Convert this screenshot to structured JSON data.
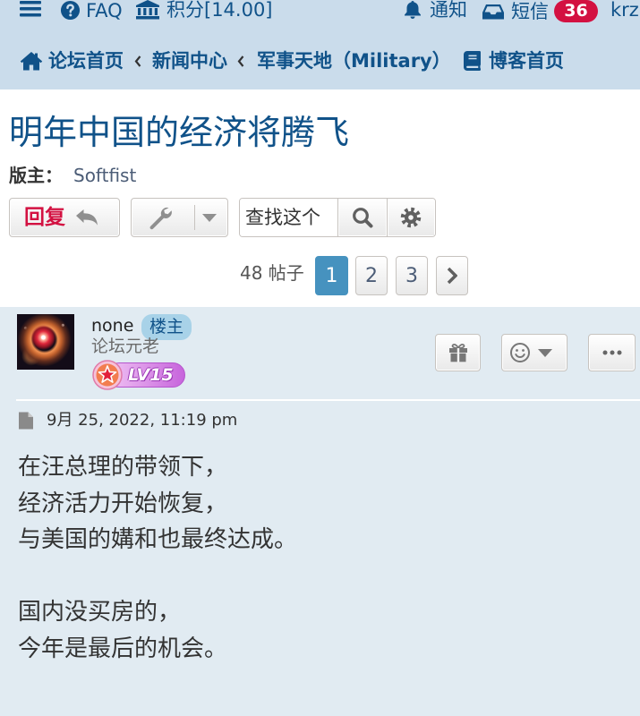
{
  "colors": {
    "link": "#105289",
    "header_bg": "#cadceb",
    "badge_red": "#d31141",
    "reply_text": "#d31141",
    "post_bg": "#e1ebf2",
    "active_page_bg": "#4692bf"
  },
  "top_nav": {
    "menu_icon": "hamburger-icon",
    "faq": {
      "icon": "question-circle-icon",
      "label": "FAQ"
    },
    "points": {
      "icon": "bank-icon",
      "label": "积分[14.00]"
    },
    "notifications": {
      "icon": "bell-icon",
      "label": "通知"
    },
    "messages": {
      "icon": "inbox-icon",
      "label": "短信",
      "count": "36"
    },
    "username": "krz"
  },
  "breadcrumb": {
    "items": [
      {
        "icon": "home-icon",
        "label": "论坛首页"
      },
      {
        "label": "新闻中心"
      },
      {
        "label": "军事天地（Military）"
      }
    ],
    "blog": {
      "icon": "book-icon",
      "label": "博客首页"
    }
  },
  "topic": {
    "title": "明年中国的经济将腾飞",
    "moderator_label": "版主：",
    "moderator": "Softfist"
  },
  "toolbar": {
    "reply_label": "回复",
    "search_placeholder": "查找这个"
  },
  "pagination": {
    "post_count": "48 帖子",
    "pages": [
      "1",
      "2",
      "3"
    ],
    "current_page": 1
  },
  "post": {
    "author": "none",
    "author_badge": "楼主",
    "rank": "论坛元老",
    "level": "LV15",
    "date": "9月 25, 2022, 11:19 pm",
    "paragraphs": [
      [
        "在汪总理的带领下，",
        "经济活力开始恢复，",
        "与美国的媾和也最终达成。"
      ],
      [
        "国内没买房的，",
        "今年是最后的机会。"
      ]
    ]
  }
}
